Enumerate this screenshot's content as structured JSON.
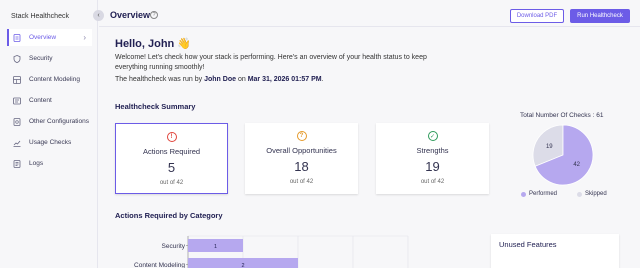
{
  "app": {
    "title": "Stack Healthcheck"
  },
  "sidebar": {
    "items": [
      {
        "label": "Overview",
        "icon": "overview-icon"
      },
      {
        "label": "Security",
        "icon": "shield-icon"
      },
      {
        "label": "Content Modeling",
        "icon": "content-model-icon"
      },
      {
        "label": "Content",
        "icon": "content-icon"
      },
      {
        "label": "Other Configurations",
        "icon": "config-icon"
      },
      {
        "label": "Usage Checks",
        "icon": "chart-icon"
      },
      {
        "label": "Logs",
        "icon": "logs-icon"
      }
    ]
  },
  "header": {
    "title": "Overview",
    "download_label": "Download PDF",
    "run_label": "Run Healthcheck"
  },
  "intro": {
    "greeting": "Hello, John 👋",
    "welcome": "Welcome! Let's check how your stack is performing. Here's an overview of your health status to keep everything running smoothly!",
    "run_prefix": "The healthcheck was run by ",
    "run_user": "John Doe",
    "run_mid": " on ",
    "run_date": "Mar 31, 2026 01:57 PM",
    "run_suffix": "."
  },
  "summary": {
    "title": "Healthcheck Summary",
    "cards": [
      {
        "label": "Actions Required",
        "value": "5",
        "sub": "out of 42",
        "icon": "alert-icon",
        "color": "#e0443b"
      },
      {
        "label": "Overall Opportunities",
        "value": "18",
        "sub": "out of 42",
        "icon": "question-icon",
        "color": "#e59a2b"
      },
      {
        "label": "Strengths",
        "value": "19",
        "sub": "out of 42",
        "icon": "check-icon",
        "color": "#2f9b5b"
      }
    ]
  },
  "total_checks": {
    "title": "Total Number Of Checks : 61",
    "legend": [
      {
        "label": "Performed",
        "color": "#b6a8ef"
      },
      {
        "label": "Skipped",
        "color": "#dcdce8"
      }
    ]
  },
  "actions_by_category": {
    "title": "Actions Required by Category"
  },
  "unused": {
    "title": "Unused Features"
  },
  "chart_data": [
    {
      "type": "pie",
      "title": "Total Number Of Checks : 61",
      "categories": [
        "Performed",
        "Skipped"
      ],
      "values": [
        42,
        19
      ],
      "colors": [
        "#b6a8ef",
        "#dcdce8"
      ]
    },
    {
      "type": "bar",
      "orientation": "horizontal",
      "title": "Actions Required by Category",
      "categories": [
        "Security",
        "Content Modeling"
      ],
      "values": [
        1,
        2
      ],
      "xlim": [
        0,
        4
      ]
    }
  ]
}
